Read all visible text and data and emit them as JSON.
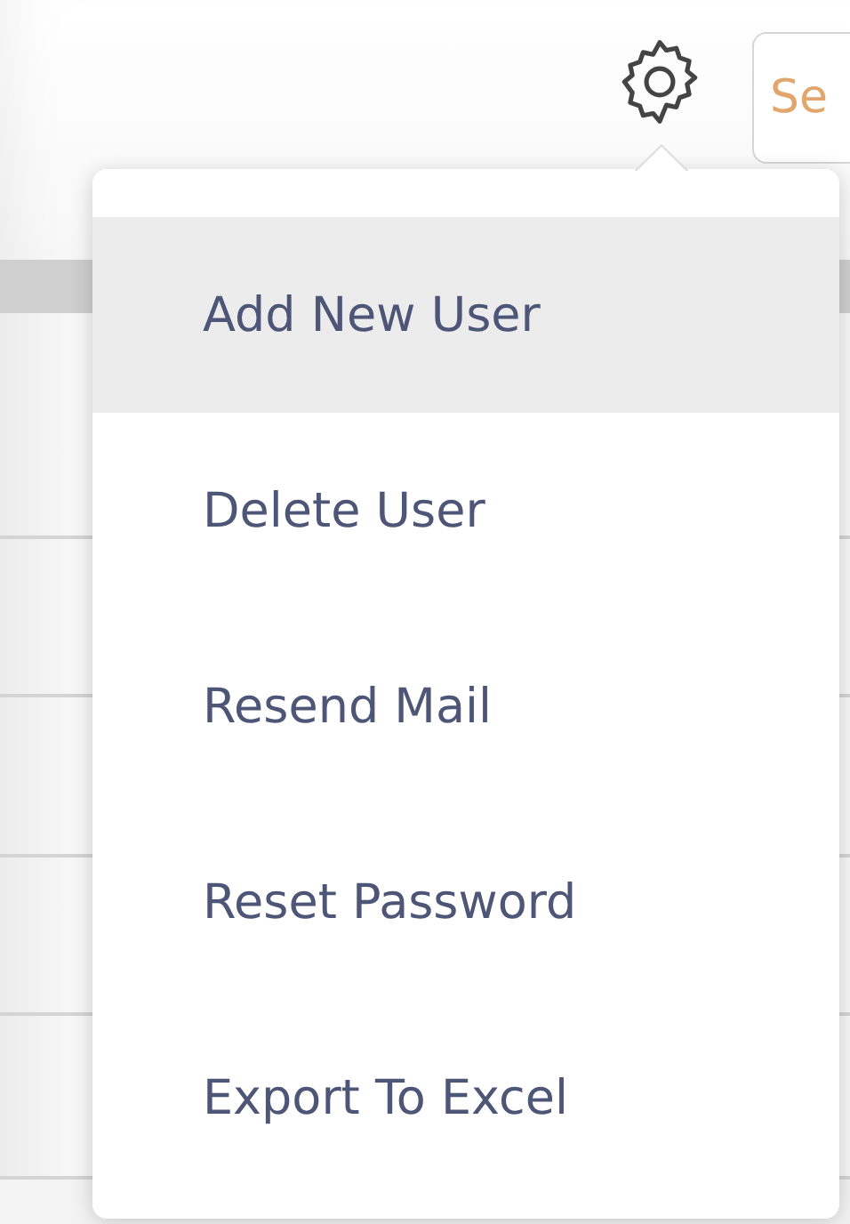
{
  "toolbar": {
    "search": {
      "placeholder": "Se"
    }
  },
  "menu": {
    "items": [
      {
        "label": "Add New User",
        "selected": true
      },
      {
        "label": "Delete User",
        "selected": false
      },
      {
        "label": "Resend Mail",
        "selected": false
      },
      {
        "label": "Reset Password",
        "selected": false
      },
      {
        "label": "Export To Excel",
        "selected": false
      }
    ]
  }
}
